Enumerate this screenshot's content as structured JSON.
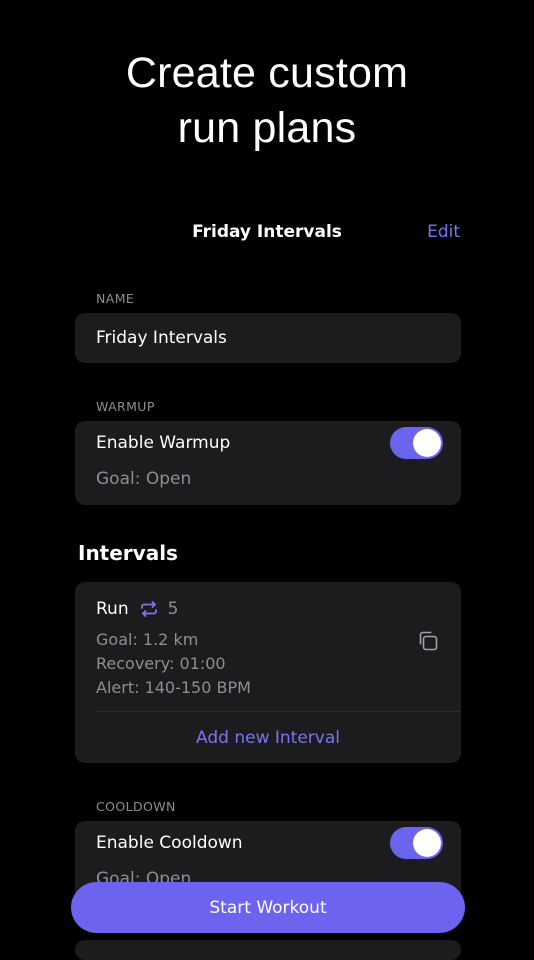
{
  "headline": {
    "line1": "Create custom",
    "line2": "run plans"
  },
  "navbar": {
    "title": "Friday Intervals",
    "edit_label": "Edit"
  },
  "name_section": {
    "label": "NAME",
    "value": "Friday Intervals"
  },
  "warmup_section": {
    "label": "WARMUP",
    "toggle_label": "Enable Warmup",
    "enabled": true,
    "goal": "Goal: Open"
  },
  "intervals": {
    "heading": "Intervals",
    "items": [
      {
        "type": "Run",
        "repeat_count": "5",
        "goal": "Goal: 1.2 km",
        "recovery": "Recovery: 01:00",
        "alert": "Alert: 140-150 BPM"
      }
    ],
    "add_label": "Add new Interval"
  },
  "cooldown_section": {
    "label": "COOLDOWN",
    "toggle_label": "Enable Cooldown",
    "enabled": true,
    "goal": "Goal: Open"
  },
  "start_button_label": "Start Workout",
  "colors": {
    "accent": "#6c63ef",
    "accent_text": "#7b74f2",
    "card_bg": "#1c1c1e",
    "secondary_text": "#8e8e93",
    "background": "#000000"
  },
  "icons": {
    "repeat": "repeat-icon",
    "copy": "copy-icon"
  }
}
